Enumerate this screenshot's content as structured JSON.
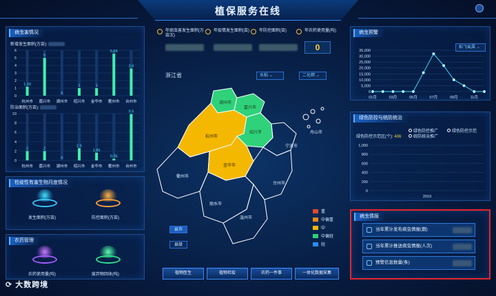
{
  "header": {
    "title": "植保服务在线"
  },
  "left": {
    "pest_panel": {
      "title": "病虫害情况",
      "chart1_label": "新增发生面积(万亩):",
      "chart2_label": "防治面积(万亩):"
    },
    "quarantine_panel": {
      "title": "检疫性有害生物月度情况",
      "item1": "发生面积(万亩)",
      "item2": "防控面积(万亩)"
    },
    "pesticide_panel": {
      "title": "农药管理",
      "item1": "农药使用量(吨)",
      "item2": "废弃物回收(吨)"
    }
  },
  "center": {
    "stats": [
      {
        "label": "年病虫害发生面积(万亩次)"
      },
      {
        "label": "年疫情发生面积(亩)"
      },
      {
        "label": "年防控面积(亩)"
      },
      {
        "label": "年农药使用量(吨)",
        "value": "0"
      }
    ],
    "province": "浙江省",
    "select_crop": "水稻",
    "select_pest": "二化螟",
    "cities": [
      "湖州市",
      "嘉兴市",
      "杭州市",
      "绍兴市",
      "宁波市",
      "金华市",
      "衢州市",
      "台州市",
      "丽水市",
      "温州市",
      "舟山市"
    ],
    "legend": [
      {
        "label": "重",
        "color": "#e04a2a"
      },
      {
        "label": "中偏重",
        "color": "#f08a1a"
      },
      {
        "label": "中",
        "color": "#f5b800"
      },
      {
        "label": "中偏轻",
        "color": "#2fd27a"
      },
      {
        "label": "轻",
        "color": "#2a8cff"
      }
    ],
    "map_buttons": [
      "县市",
      "县级"
    ],
    "buttons": [
      "植物医生",
      "植物检疫",
      "农药一件事",
      "一体化数据采集"
    ]
  },
  "right": {
    "warning_panel": {
      "title": "病虫预警",
      "select": "稻飞虱属"
    },
    "green_panel": {
      "title": "绿色防控与统防统治",
      "summary_label": "绿色防控示范区(个): ",
      "summary_value": "406",
      "legend": [
        "绿色防控推广",
        "绿色防控示范",
        "统防统治推广"
      ],
      "year": "2019"
    },
    "info_panel": {
      "title": "病虫情报",
      "rows": [
        "当年累计发布病虫情报(期)",
        "当年累计推送病虫情报(人次)",
        "预警信息数量(条)"
      ]
    }
  },
  "watermark": "大数跨境",
  "chart_data": [
    {
      "type": "bar",
      "title": "新增发生面积(万亩)",
      "categories": [
        "杭州市",
        "嘉兴市",
        "湖州市",
        "绍兴市",
        "金华市",
        "衢州市",
        "台州市"
      ],
      "values": [
        1.19,
        5,
        0,
        1,
        1,
        5.55,
        3.6
      ],
      "ylim": [
        0,
        6
      ],
      "yticks": [
        0,
        1,
        2,
        3,
        4,
        5,
        6
      ]
    },
    {
      "type": "bar",
      "title": "防治面积(万亩)",
      "categories": [
        "杭州市",
        "嘉兴市",
        "湖州市",
        "绍兴市",
        "金华市",
        "衢州市",
        "台州市"
      ],
      "values": [
        2,
        2,
        0,
        2.6,
        1.65,
        0.35,
        9.9
      ],
      "ylim": [
        0,
        10
      ],
      "yticks": [
        0,
        2,
        4,
        6,
        8,
        10
      ]
    },
    {
      "type": "line",
      "title": "病虫预警",
      "x": [
        "01月",
        "02月",
        "03月",
        "04月",
        "05月",
        "06月",
        "07月",
        "08月",
        "09月",
        "10月",
        "11月",
        "12月"
      ],
      "xticks": [
        "01月",
        "03月",
        "05月",
        "07月",
        "09月",
        "11月"
      ],
      "values": [
        0,
        0,
        0,
        0,
        0,
        16000,
        32000,
        22000,
        10000,
        5000,
        0,
        0
      ],
      "ylim": [
        0,
        35000
      ],
      "yticks": [
        0,
        5000,
        10000,
        15000,
        20000,
        25000,
        30000,
        35000
      ]
    },
    {
      "type": "bar",
      "title": "绿色防控与统防统治",
      "categories": [
        "2019"
      ],
      "series": [],
      "ylim": [
        0,
        1000
      ],
      "yticks": [
        0,
        200,
        400,
        600,
        800,
        1000
      ]
    }
  ]
}
